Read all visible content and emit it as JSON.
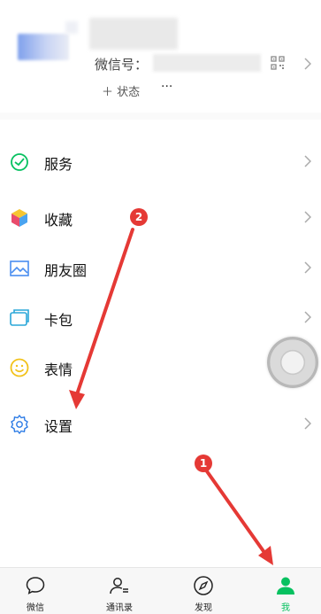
{
  "profile": {
    "wechat_id_label": "微信号：",
    "status_label": "＋ 状态",
    "more_label": "···"
  },
  "menu": [
    {
      "label": "服务",
      "icon": "service-icon"
    },
    {
      "label": "收藏",
      "icon": "favorites-icon"
    },
    {
      "label": "朋友圈",
      "icon": "moments-icon"
    },
    {
      "label": "卡包",
      "icon": "card-wallet-icon"
    },
    {
      "label": "表情",
      "icon": "sticker-icon"
    },
    {
      "label": "设置",
      "icon": "settings-icon"
    }
  ],
  "annotations": {
    "badge1": "1",
    "badge2": "2",
    "color": "#e53935"
  },
  "tabs": [
    {
      "label": "微信",
      "icon": "chat-icon"
    },
    {
      "label": "通讯录",
      "icon": "contacts-icon"
    },
    {
      "label": "发现",
      "icon": "discover-icon"
    },
    {
      "label": "我",
      "icon": "me-icon"
    }
  ],
  "colors": {
    "accent": "#07c160",
    "annotation": "#e53935"
  }
}
